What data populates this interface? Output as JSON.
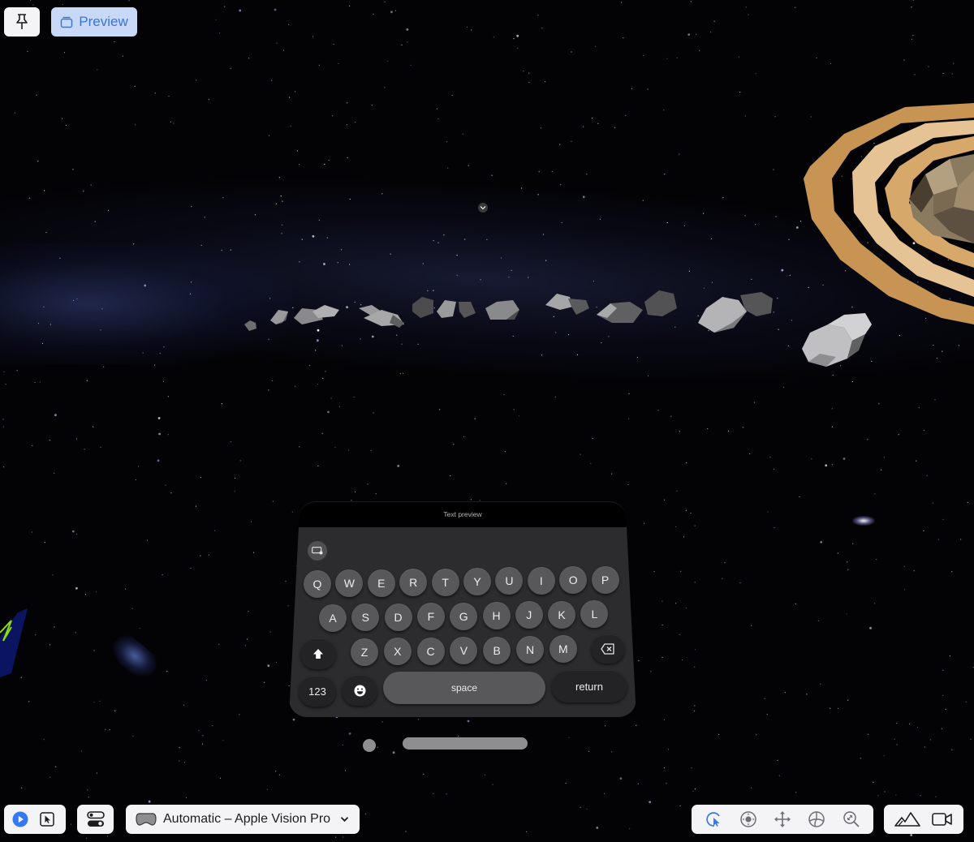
{
  "top_toolbar": {
    "pin_icon": "pin-icon",
    "preview_label": "Preview",
    "preview_icon": "window-stack-icon"
  },
  "scene": {
    "description": "Immersive space scene with Milky Way, asteroid belt, and low-poly Saturn",
    "collapse_control_icon": "chevron-down-icon"
  },
  "keyboard": {
    "text_preview_label": "Text preview",
    "rows": [
      [
        "Q",
        "W",
        "E",
        "R",
        "T",
        "Y",
        "U",
        "I",
        "O",
        "P"
      ],
      [
        "A",
        "S",
        "D",
        "F",
        "G",
        "H",
        "J",
        "K",
        "L"
      ],
      [
        "Z",
        "X",
        "C",
        "V",
        "B",
        "N",
        "M"
      ]
    ],
    "shift_icon": "shift-icon",
    "delete_icon": "delete-backward-icon",
    "numbers_label": "123",
    "emoji_icon": "emoji-icon",
    "space_label": "space",
    "return_label": "return",
    "keyboard_toggle_icon": "keyboard-icon"
  },
  "bottom_toolbar": {
    "play_icon": "play-icon",
    "select_icon": "cursor-select-icon",
    "settings_icon": "toggles-icon",
    "device_icon": "vision-pro-icon",
    "device_label": "Automatic – Apple Vision Pro",
    "device_chevron": "chevron-down-icon",
    "camera_tools": [
      {
        "name": "interact",
        "icon": "interact-cursor-icon",
        "active": true
      },
      {
        "name": "look",
        "icon": "look-around-icon",
        "active": false
      },
      {
        "name": "pan",
        "icon": "pan-arrows-icon",
        "active": false
      },
      {
        "name": "orbit",
        "icon": "orbit-icon",
        "active": false
      },
      {
        "name": "zoom",
        "icon": "zoom-icon",
        "active": false
      }
    ],
    "environment_icon": "mountains-icon",
    "camera_icon": "video-camera-icon"
  },
  "colors": {
    "accent": "#3478f6",
    "preview_bg": "#c7d9f7",
    "toolbar_bg": "#f4f4f6",
    "key_fill": "#58585b",
    "keyboard_bg": "#2c2c2e"
  }
}
